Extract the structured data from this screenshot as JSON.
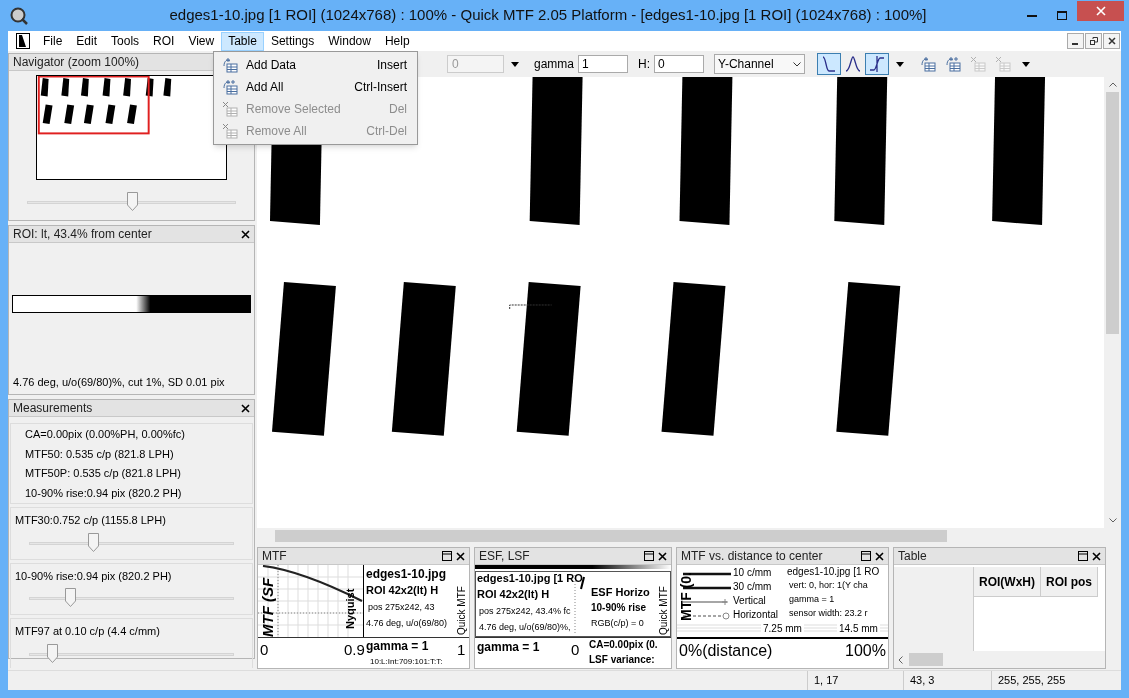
{
  "window": {
    "title": "edges1-10.jpg [1 ROI] (1024x768) : 100% - Quick MTF 2.05 Platform - [edges1-10.jpg [1 ROI] (1024x768) : 100%]"
  },
  "menu": [
    {
      "label": "File",
      "selected": false
    },
    {
      "label": "Edit",
      "selected": false
    },
    {
      "label": "Tools",
      "selected": false
    },
    {
      "label": "ROI",
      "selected": false
    },
    {
      "label": "View",
      "selected": false
    },
    {
      "label": "Table",
      "selected": true
    },
    {
      "label": "Settings",
      "selected": false
    },
    {
      "label": "Window",
      "selected": false
    },
    {
      "label": "Help",
      "selected": false
    }
  ],
  "table_menu": [
    {
      "label": "Add Data",
      "shortcut": "Insert",
      "disabled": false,
      "kind": "add"
    },
    {
      "label": "Add All",
      "shortcut": "Ctrl-Insert",
      "disabled": false,
      "kind": "add-all"
    },
    {
      "label": "Remove Selected",
      "shortcut": "Del",
      "disabled": true,
      "kind": "remove"
    },
    {
      "label": "Remove All",
      "shortcut": "Ctrl-Del",
      "disabled": true,
      "kind": "remove-all"
    }
  ],
  "toolbar": {
    "field_1": "0",
    "gamma_label": "gamma",
    "gamma": "1",
    "h_label": "H:",
    "h": "0",
    "channel": "Y-Channel",
    "curves": [
      {
        "kind": "esf",
        "selected": true
      },
      {
        "kind": "lsf",
        "selected": false
      },
      {
        "kind": "mtf",
        "selected": true
      }
    ],
    "table_buttons": [
      {
        "kind": "add",
        "disabled": false
      },
      {
        "kind": "add-all",
        "disabled": false
      },
      {
        "kind": "remove",
        "disabled": true
      },
      {
        "kind": "remove-all",
        "disabled": true
      }
    ]
  },
  "navigator": {
    "title": "Navigator (zoom 100%)",
    "slider": {
      "level": 0.5
    }
  },
  "roi": {
    "title": "ROI: lt, 43.4% from center",
    "info": "4.76 deg, u/o(69/80)%, cut 1%, SD 0.01 pix"
  },
  "measurements": {
    "title": "Measurements",
    "lines": [
      "CA=0.00pix (0.00%PH, 0.00%fc)",
      "MTF50: 0.535 c/p (821.8 LPH)",
      "MTF50P: 0.535 c/p (821.8 LPH)",
      "10-90% rise:0.94 pix (820.2 PH)"
    ],
    "sliders": [
      {
        "label": "MTF30:0.752 c/p (1155.8 LPH)",
        "level": 0.31
      },
      {
        "label": "10-90% rise:0.94 pix (820.2 PH)",
        "level": 0.2
      },
      {
        "label": "MTF97 at 0.10 c/p (4.4 c/mm)",
        "level": 0.11
      }
    ]
  },
  "panels": [
    {
      "title": "MTF",
      "kind": "mtf",
      "texts": [
        "MTF (SF",
        "Nyquist",
        "edges1-10.jpg",
        "ROI 42x2(lt) H",
        "pos 275x242, 43",
        "4.76 deg, u/o(69/80)",
        "Quick MTF",
        "0",
        "0.9",
        "gamma = 1",
        "1",
        "10:L:Int:709:101:T:T:"
      ]
    },
    {
      "title": "ESF, LSF",
      "kind": "esf",
      "texts": [
        "edges1-10.jpg [1 RO",
        "ROI 42x2(lt) H",
        "pos 275x242, 43.4% fc",
        "4.76 deg, u/o(69/80)%,",
        "ESF Horizo",
        "10-90% rise",
        "RGB(c/p) = 0",
        "Quick MTF",
        "gamma = 1",
        "0",
        "CA=0.00pix (0.",
        "LSF variance:"
      ]
    },
    {
      "title": "MTF vs. distance to center",
      "kind": "distance",
      "texts": [
        "10 c/mm",
        "30 c/mm",
        "Vertical",
        "Horizontal",
        "MTF (0.",
        "edges1-10.jpg [1 RO",
        "vert: 0, hor: 1(Y cha",
        "gamma = 1",
        "sensor width: 23.2 r",
        "7.25 mm",
        "14.5 mm",
        "0%(distance)",
        "100%"
      ]
    },
    {
      "title": "Table",
      "kind": "table",
      "columns": [
        "ROI(WxH)",
        "ROI pos"
      ]
    }
  ],
  "status_bar": [
    "1, 17",
    "43, 3",
    "255, 255, 255"
  ]
}
